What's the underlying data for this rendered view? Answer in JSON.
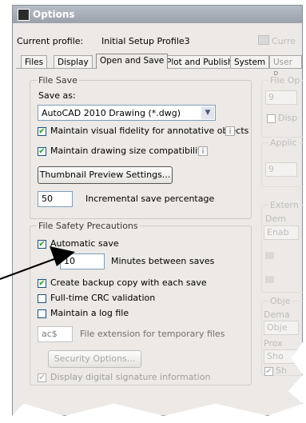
{
  "window": {
    "title": "Options"
  },
  "profile": {
    "label": "Current profile:",
    "value": "Initial Setup Profile3",
    "right_label": "Curre"
  },
  "tabs": [
    {
      "label": "Files"
    },
    {
      "label": "Display"
    },
    {
      "label": "Open and Save"
    },
    {
      "label": "Plot and Publish"
    },
    {
      "label": "System"
    },
    {
      "label": "User R"
    }
  ],
  "file_save": {
    "group_title": "File Save",
    "save_as_label": "Save as:",
    "save_as_value": "AutoCAD 2010 Drawing (*.dwg)",
    "maintain_visual_fidelity": "Maintain visual fidelity for annotative objects",
    "maintain_drawing_size": "Maintain drawing size compatibility",
    "thumbnail_button": "Thumbnail Preview Settings...",
    "incremental_value": "50",
    "incremental_label": "Incremental save percentage"
  },
  "safety": {
    "group_title": "File Safety Precautions",
    "automatic_save": "Automatic save",
    "minutes_value": "10",
    "minutes_label": "Minutes between saves",
    "backup_copy": "Create backup copy with each save",
    "crc_validation": "Full-time CRC validation",
    "log_file": "Maintain a log file",
    "temp_ext_value": "ac$",
    "temp_ext_label": "File extension for temporary files",
    "security_button": "Security Options...",
    "digital_signature": "Display digital signature information"
  },
  "right_panel": {
    "file_open_title": "File Op",
    "file_open_value": "9",
    "display_label": "Disp",
    "appl_title": "Applic",
    "appl_value": "9",
    "external_title": "Extern",
    "demand_label": "Dem",
    "enable_value": "Enab",
    "objects_title": "Obje",
    "demand2_label": "Dema",
    "obj_value": "Obje",
    "proxy_label": "Prox",
    "show_value": "Sho",
    "show_label": "Sh"
  }
}
